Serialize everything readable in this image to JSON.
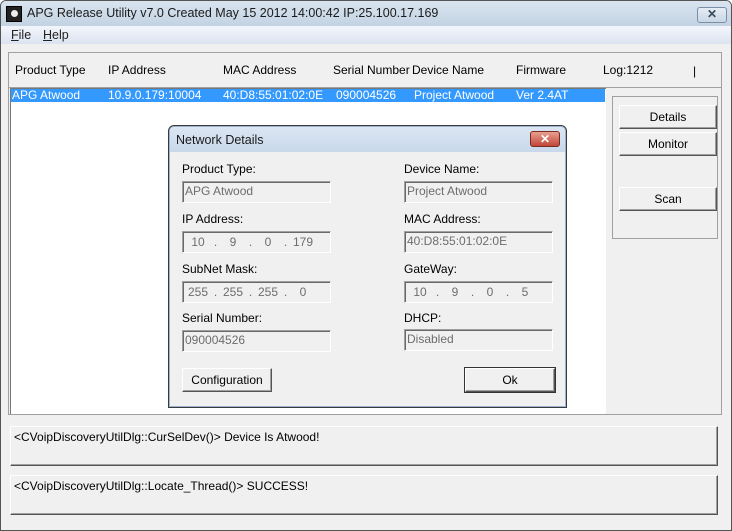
{
  "window": {
    "title": "APG Release Utility v7.0 Created May 15 2012 14:00:42   IP:25.100.17.169",
    "close_icon": "close-icon"
  },
  "menu": {
    "items": [
      {
        "label": "File",
        "accel": "F"
      },
      {
        "label": "Help",
        "accel": "H"
      }
    ]
  },
  "device_list": {
    "columns": [
      "Product Type",
      "IP Address",
      "MAC Address",
      "Serial Number",
      "Device Name",
      "Firmware",
      "Log:1212",
      "|"
    ],
    "rows": [
      {
        "product_type": "APG Atwood",
        "ip_address": "10.9.0.179:10004",
        "mac_address": "40:D8:55:01:02:0E",
        "serial_number": "090004526",
        "device_name": "Project Atwood",
        "firmware": "Ver 2.4AT",
        "selected": true
      }
    ],
    "selection_color": "#3399ff"
  },
  "actions": {
    "details": "Details",
    "monitor": "Monitor",
    "scan": "Scan"
  },
  "status": {
    "line1": "<CVoipDiscoveryUtilDlg::CurSelDev()> Device Is Atwood!",
    "line2": "<CVoipDiscoveryUtilDlg::Locate_Thread()> SUCCESS!"
  },
  "dialog": {
    "title": "Network Details",
    "close_icon": "close-icon",
    "fields": {
      "product_type": {
        "label": "Product Type:",
        "value": "APG Atwood"
      },
      "device_name": {
        "label": "Device Name:",
        "value": "Project Atwood"
      },
      "ip_address": {
        "label": "IP Address:",
        "octets": [
          "10",
          "9",
          "0",
          "179"
        ]
      },
      "mac_address": {
        "label": "MAC Address:",
        "value": "40:D8:55:01:02:0E"
      },
      "subnet_mask": {
        "label": "SubNet Mask:",
        "octets": [
          "255",
          "255",
          "255",
          "0"
        ]
      },
      "gateway": {
        "label": "GateWay:",
        "octets": [
          "10",
          "9",
          "0",
          "5"
        ]
      },
      "serial_number": {
        "label": "Serial Number:",
        "value": "090004526"
      },
      "dhcp": {
        "label": "DHCP:",
        "value": "Disabled"
      }
    },
    "buttons": {
      "configuration": "Configuration",
      "ok": "Ok"
    }
  }
}
